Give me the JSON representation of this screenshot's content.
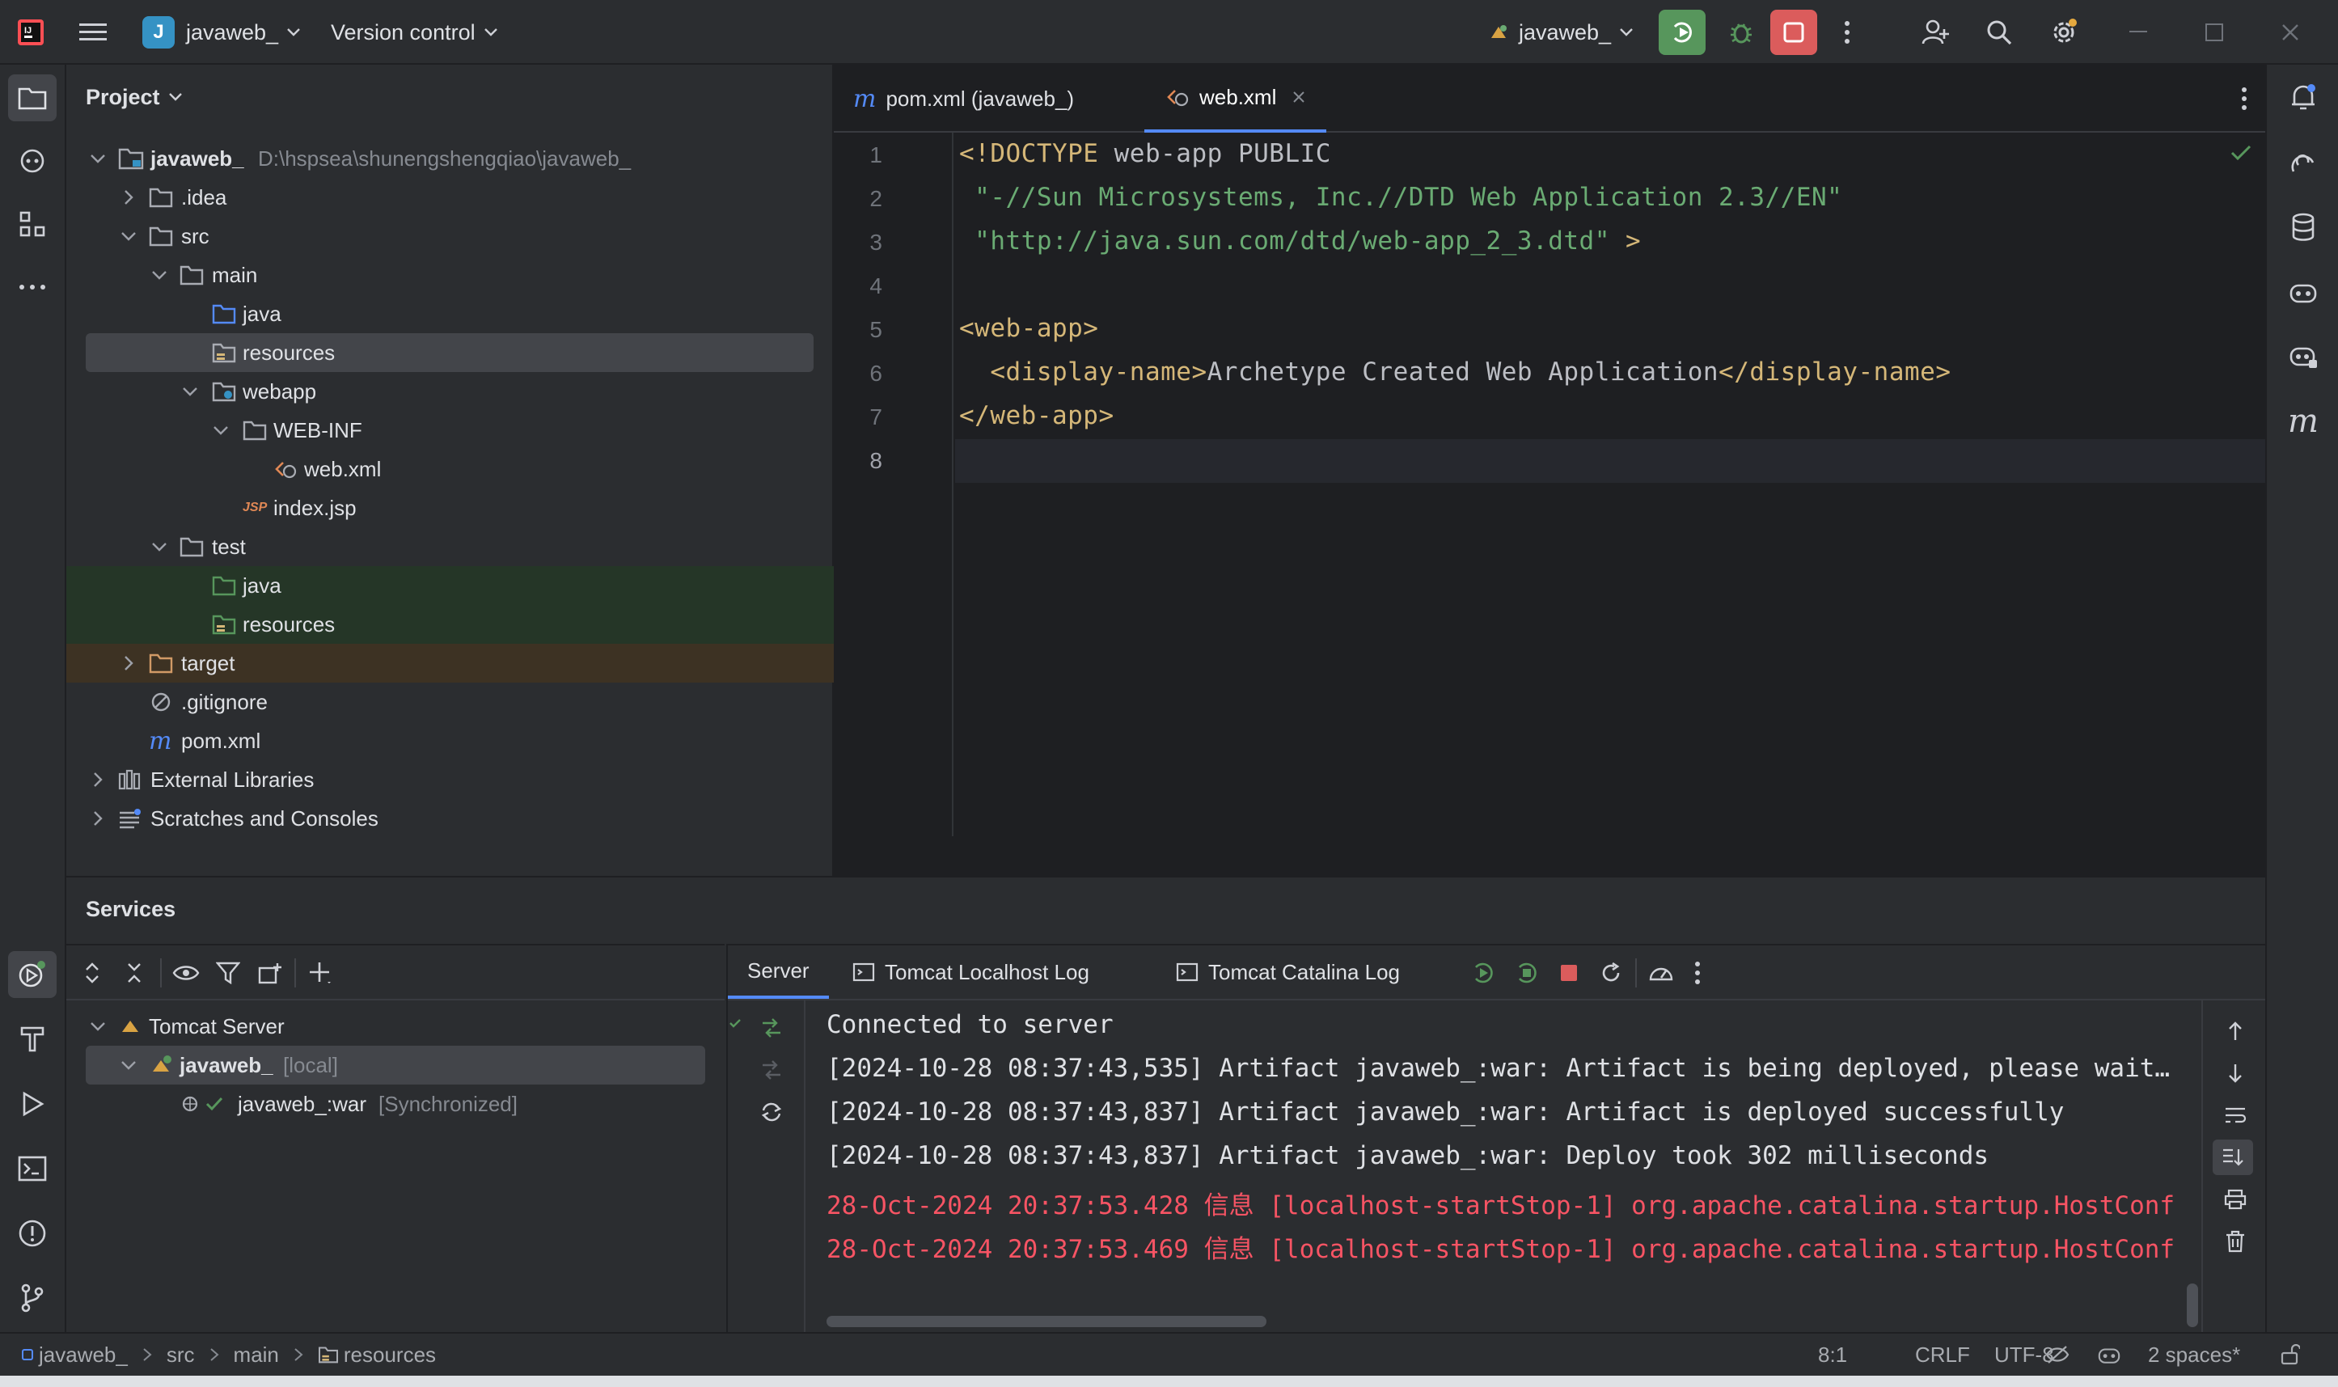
{
  "titlebar": {
    "project_badge": "J",
    "project_name": "javaweb_",
    "vcs_label": "Version control",
    "run_config": "javaweb_",
    "colors": {
      "run_green": "#57965c",
      "stop_red": "#db5c5c",
      "badge_blue": "#3592c4"
    }
  },
  "project_pane": {
    "title": "Project",
    "tree": [
      {
        "label": "javaweb_",
        "path": "D:\\hspsea\\shunengshengqiao\\javaweb_",
        "icon": "module-folder-icon",
        "expanded": true
      },
      {
        "label": ".idea",
        "icon": "folder-icon",
        "expanded": false
      },
      {
        "label": "src",
        "icon": "folder-icon",
        "expanded": true
      },
      {
        "label": "main",
        "icon": "folder-icon",
        "expanded": true
      },
      {
        "label": "java",
        "icon": "source-folder-icon"
      },
      {
        "label": "resources",
        "icon": "resources-folder-icon",
        "selected": true
      },
      {
        "label": "webapp",
        "icon": "web-folder-icon",
        "expanded": true
      },
      {
        "label": "WEB-INF",
        "icon": "folder-icon",
        "expanded": true
      },
      {
        "label": "web.xml",
        "icon": "web-xml-icon"
      },
      {
        "label": "index.jsp",
        "icon": "jsp-icon"
      },
      {
        "label": "test",
        "icon": "folder-icon",
        "expanded": true
      },
      {
        "label": "java",
        "icon": "test-source-folder-icon"
      },
      {
        "label": "resources",
        "icon": "test-resources-folder-icon"
      },
      {
        "label": "target",
        "icon": "excluded-folder-icon",
        "expanded": false
      },
      {
        "label": ".gitignore",
        "icon": "ignore-file-icon"
      },
      {
        "label": "pom.xml",
        "icon": "maven-icon"
      },
      {
        "label": "External Libraries",
        "icon": "library-icon",
        "expanded": false
      },
      {
        "label": "Scratches and Consoles",
        "icon": "scratches-icon",
        "expanded": false
      }
    ]
  },
  "editor": {
    "tabs": [
      {
        "label": "pom.xml (javaweb_)",
        "icon": "maven-icon",
        "active": false
      },
      {
        "label": "web.xml",
        "icon": "web-xml-icon",
        "active": true
      }
    ],
    "line_numbers": [
      "1",
      "2",
      "3",
      "4",
      "5",
      "6",
      "7",
      "8"
    ],
    "lines": [
      {
        "kw": "<!DOCTYPE",
        "rest": " web-app PUBLIC"
      },
      {
        "str": " \"-//Sun Microsystems, Inc.//DTD Web Application 2.3//EN\""
      },
      {
        "str": " \"http://java.sun.com/dtd/web-app_2_3.dtd\"",
        "kw2": " >"
      },
      {},
      {
        "tag": "<web-app>"
      },
      {
        "indent": "  ",
        "open": "<display-name>",
        "text": "Archetype Created Web Application",
        "close": "</display-name>"
      },
      {
        "tag": "</web-app>"
      },
      {}
    ]
  },
  "services": {
    "title": "Services",
    "tree": {
      "server": "Tomcat Server",
      "instance": "javaweb_",
      "instance_tag": "[local]",
      "artifact": "javaweb_:war",
      "artifact_tag": "[Synchronized]"
    },
    "console_tabs": [
      "Server",
      "Tomcat Localhost Log",
      "Tomcat Catalina Log"
    ],
    "log": [
      {
        "text": "Connected to server",
        "error": false
      },
      {
        "text": "[2024-10-28 08:37:43,535] Artifact javaweb_:war: Artifact is being deployed, please wait…",
        "error": false
      },
      {
        "text": "[2024-10-28 08:37:43,837] Artifact javaweb_:war: Artifact is deployed successfully",
        "error": false
      },
      {
        "text": "[2024-10-28 08:37:43,837] Artifact javaweb_:war: Deploy took 302 milliseconds",
        "error": false
      },
      {
        "text": "28-Oct-2024 20:37:53.428 信息 [localhost-startStop-1] org.apache.catalina.startup.HostConf",
        "error": true
      },
      {
        "text": "28-Oct-2024 20:37:53.469 信息 [localhost-startStop-1] org.apache.catalina.startup.HostConf",
        "error": true
      }
    ]
  },
  "statusbar": {
    "breadcrumbs": [
      "javaweb_",
      "src",
      "main",
      "resources"
    ],
    "position": "8:1",
    "line_sep": "CRLF",
    "encoding": "UTF-8",
    "indent": "2 spaces*"
  }
}
